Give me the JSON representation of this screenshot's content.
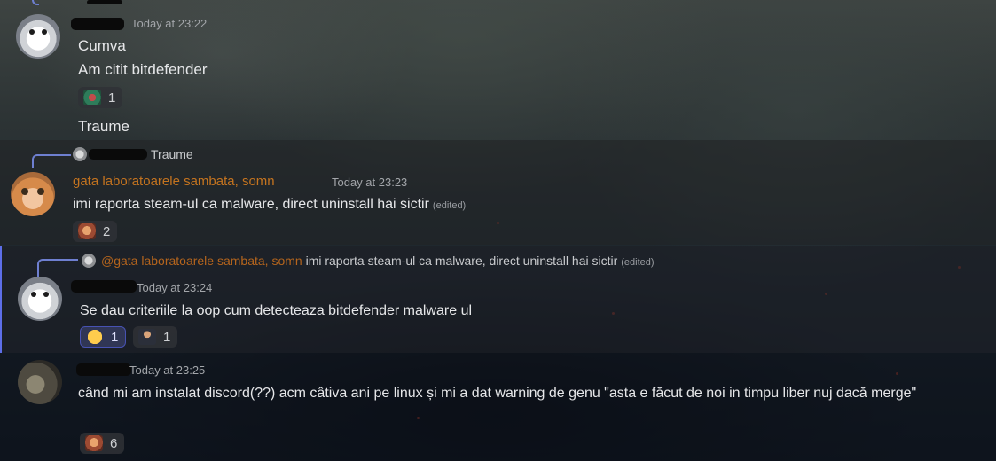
{
  "messages": [
    {
      "timestamp": "Today at 23:22",
      "lines": [
        "Cumva",
        "Am citit bitdefender"
      ],
      "reactions": [
        {
          "icon": "cowboy-pepe-emoji",
          "count": "1"
        }
      ],
      "extra_line": "Traume"
    },
    {
      "reply": {
        "text": "Traume"
      },
      "author": "gata laboratoarele sambata, somn",
      "timestamp": "Today at 23:23",
      "text": "imi raporta steam-ul ca malware, direct uninstall hai sictir",
      "edited": "(edited)",
      "reactions": [
        {
          "icon": "face-emoji",
          "count": "2"
        }
      ]
    },
    {
      "reply": {
        "mention": "@gata laboratoarele sambata, somn",
        "text": "imi raporta steam-ul ca malware, direct uninstall hai sictir",
        "edited": "(edited)"
      },
      "timestamp": "Today at 23:24",
      "text": "Se dau criteriile la oop cum detecteaza bitdefender malware ul",
      "reactions": [
        {
          "icon": "joy-emoji",
          "count": "1"
        },
        {
          "icon": "man-emoji",
          "count": "1"
        }
      ]
    },
    {
      "timestamp": "Today at 23:25",
      "text": "când mi am instalat discord(??) acm câtiva ani pe linux și mi a dat warning de genu \"asta e făcut de noi in timpu liber nuj dacă merge\"",
      "reactions": [
        {
          "icon": "face-emoji",
          "count": "6"
        }
      ]
    }
  ],
  "colors": {
    "username": "#c4741f",
    "mention_border": "#5d6ee8",
    "text": "#e6e7e9",
    "timestamp": "#a3a6aa"
  }
}
